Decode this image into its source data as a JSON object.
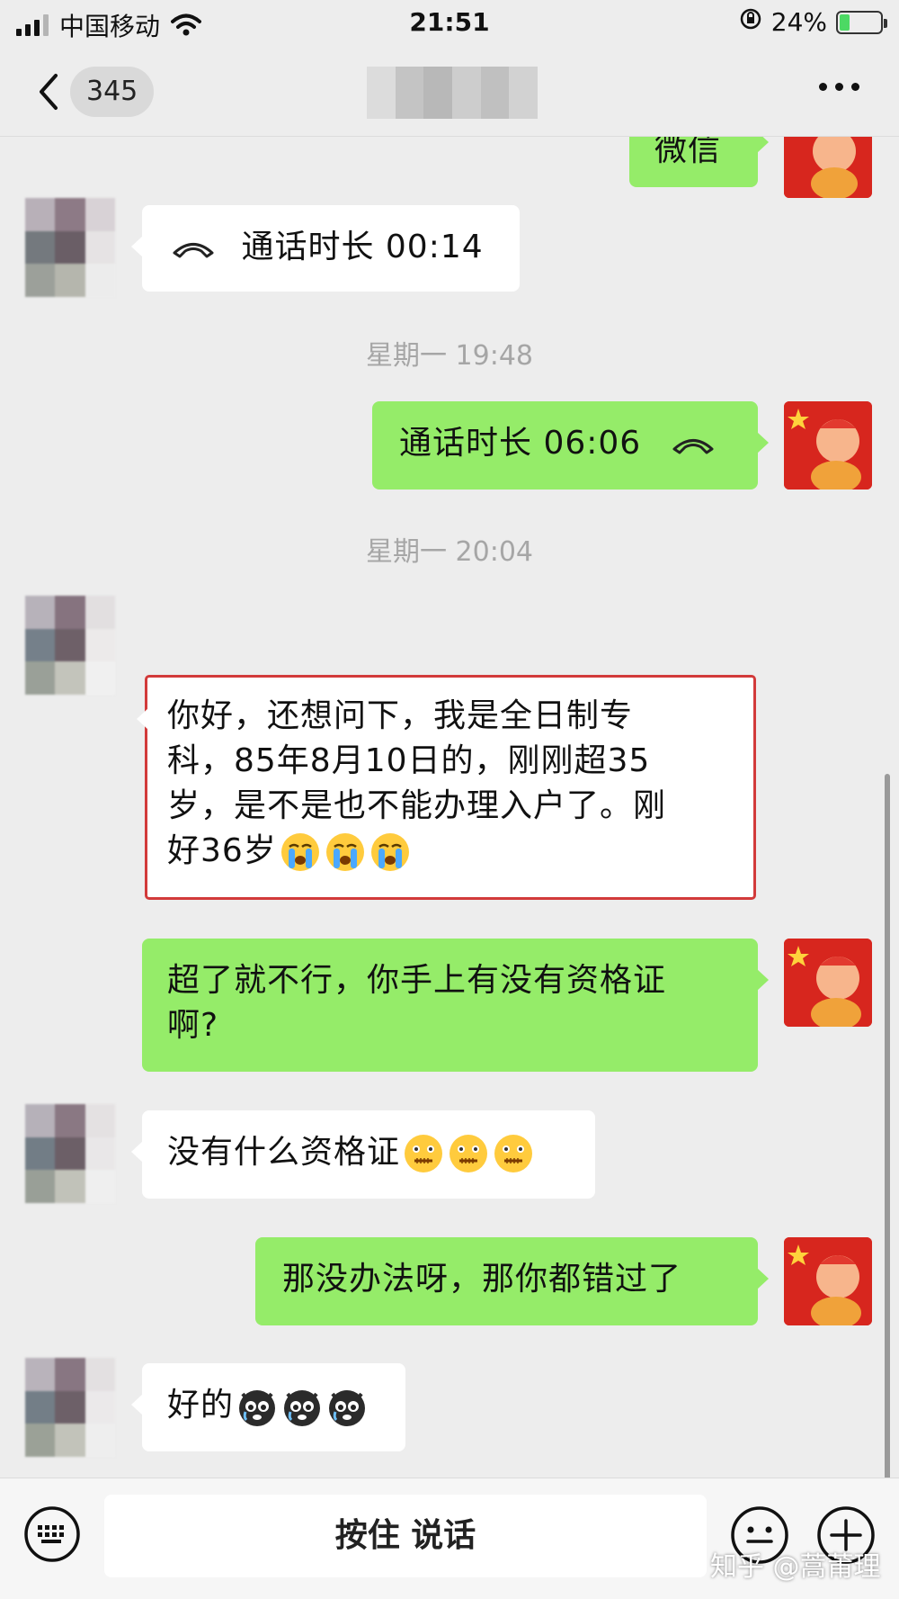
{
  "status_bar": {
    "carrier": "中国移动",
    "time": "21:51",
    "battery_percent": "24%",
    "battery_level": 0.24
  },
  "nav": {
    "unread_count": "345"
  },
  "messages": {
    "top_partial": "微信",
    "call_in": "通话时长 00:14",
    "ts1": "星期一 19:48",
    "call_out": "通话时长 06:06",
    "ts2": "星期一 20:04",
    "q_line1": "你好，还想问下，我是全日制专",
    "q_line2": "科，85年8月10日的，刚刚超35",
    "q_line3": "岁，是不是也不能办理入户了。刚",
    "q_line4": "好36岁",
    "a1_line1": "超了就不行，你手上有没有资格证",
    "a1_line2": "啊?",
    "reply1": "没有什么资格证",
    "a2": "那没办法呀，那你都错过了",
    "reply2": "好的"
  },
  "input_bar": {
    "hold_to_talk": "按住 说话"
  },
  "watermark": "知乎 @蒿莆理",
  "colors": {
    "background": "#ededed",
    "outgoing_bubble": "#95ec69",
    "incoming_bubble": "#ffffff",
    "highlight_border": "#d23a3a"
  }
}
